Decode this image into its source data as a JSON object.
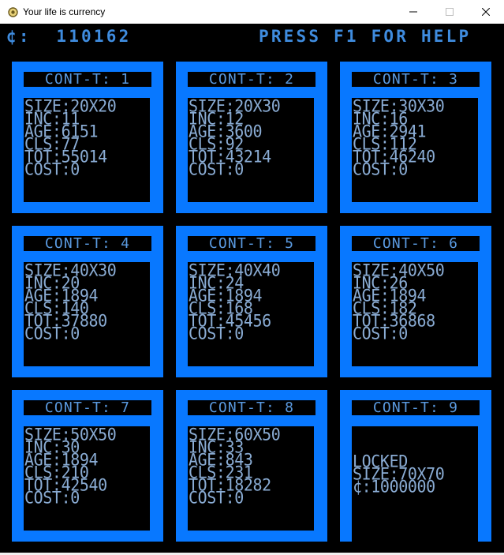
{
  "window": {
    "title": "Your life is currency",
    "controls": [
      "minimize-icon",
      "maximize-icon",
      "close-icon"
    ]
  },
  "hud": {
    "money": "¢:  110162",
    "help": "PRESS F1 FOR HELP"
  },
  "colors": {
    "container_border": "#0878ff",
    "text_blue": "#5a9ae0",
    "background": "#000000"
  },
  "containers": [
    {
      "title": "CONT-T: 1",
      "size": "SIZE:20X20",
      "inc": "INC:11",
      "age": "AGE:6151",
      "cls": "CLS:77",
      "tot": "TOT:55014",
      "cost": "COST:0"
    },
    {
      "title": "CONT-T: 2",
      "size": "SIZE:20X30",
      "inc": "INC:12",
      "age": "AGE:3600",
      "cls": "CLS:92",
      "tot": "TOT:43214",
      "cost": "COST:0"
    },
    {
      "title": "CONT-T: 3",
      "size": "SIZE:30X30",
      "inc": "INC:16",
      "age": "AGE:2941",
      "cls": "CLS:112",
      "tot": "TOT:46240",
      "cost": "COST:0"
    },
    {
      "title": "CONT-T: 4",
      "size": "SIZE:40X30",
      "inc": "INC:20",
      "age": "AGE:1894",
      "cls": "CLS:140",
      "tot": "TOT:37880",
      "cost": "COST:0"
    },
    {
      "title": "CONT-T: 5",
      "size": "SIZE:40X40",
      "inc": "INC:24",
      "age": "AGE:1894",
      "cls": "CLS:168",
      "tot": "TOT:45456",
      "cost": "COST:0"
    },
    {
      "title": "CONT-T: 6",
      "size": "SIZE:40X50",
      "inc": "INC:26",
      "age": "AGE:1894",
      "cls": "CLS:182",
      "tot": "TOT:36868",
      "cost": "COST:0"
    },
    {
      "title": "CONT-T: 7",
      "size": "SIZE:50X50",
      "inc": "INC:30",
      "age": "AGE:1894",
      "cls": "CLS:210",
      "tot": "TOT:42540",
      "cost": "COST:0"
    },
    {
      "title": "CONT-T: 8",
      "size": "SIZE:60X50",
      "inc": "INC:33",
      "age": "AGE:843",
      "cls": "CLS:231",
      "tot": "TOT:18282",
      "cost": "COST:0"
    },
    {
      "title": "CONT-T: 9",
      "locked": "LOCKED",
      "size": "SIZE:70X70",
      "price": "¢:1000000"
    }
  ]
}
